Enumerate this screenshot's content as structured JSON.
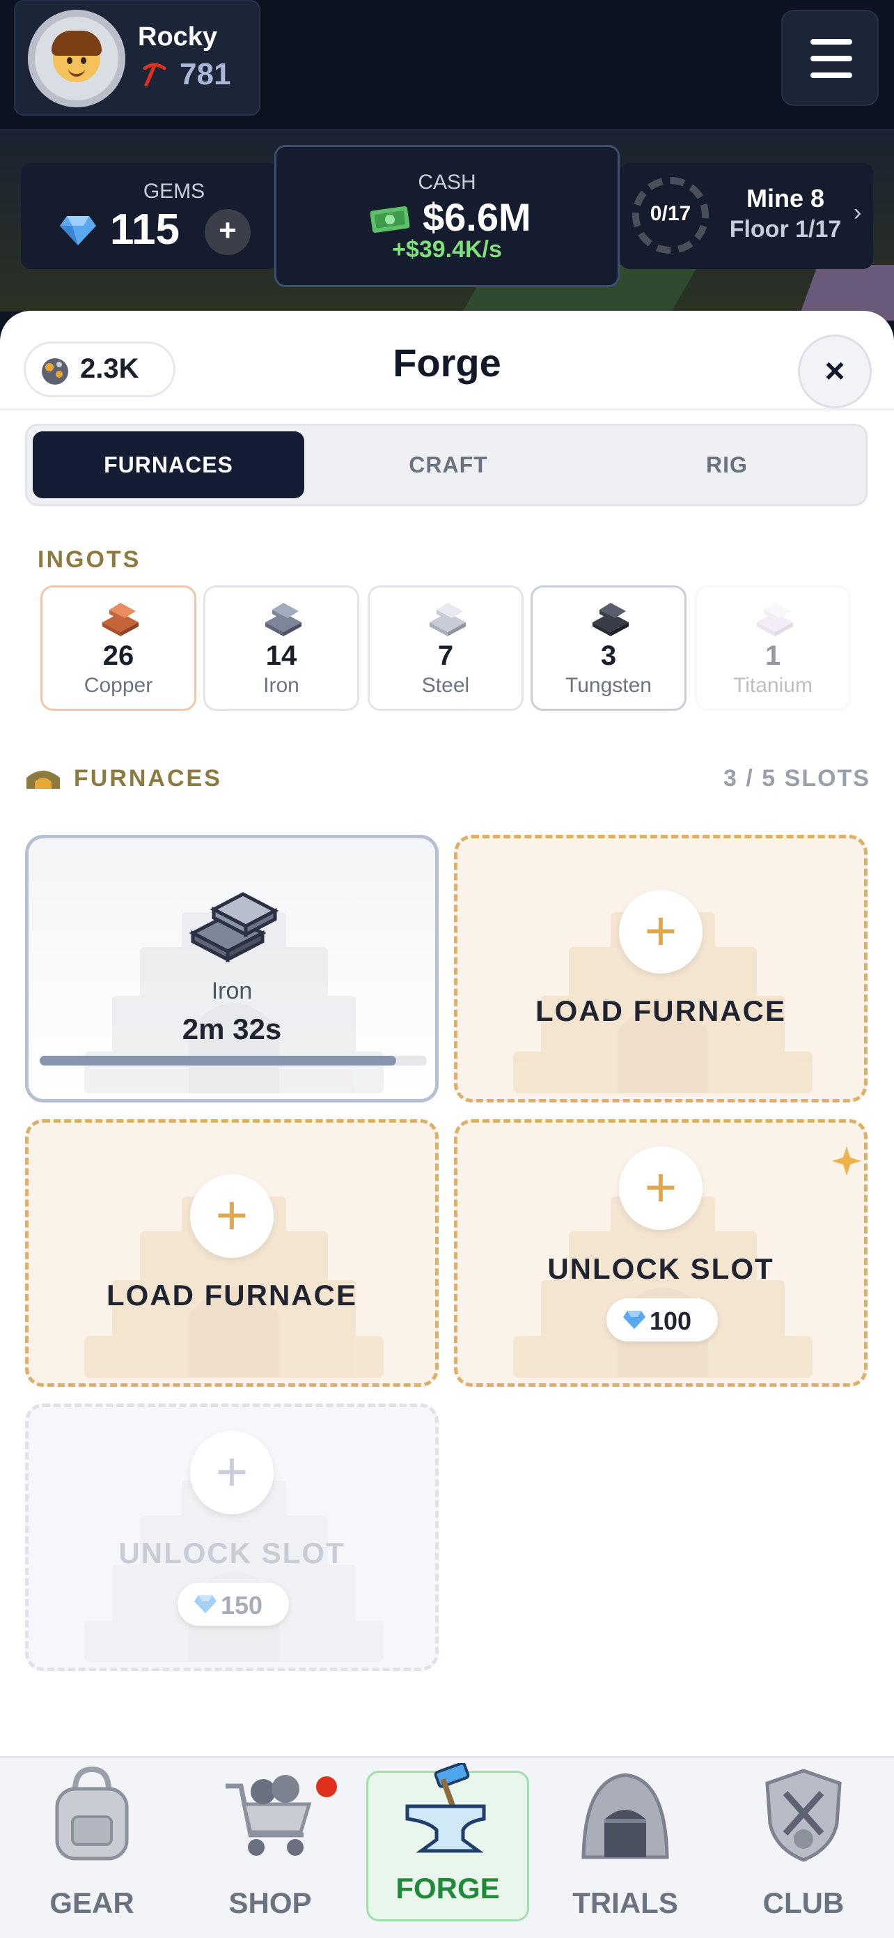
{
  "player": {
    "name": "Rocky",
    "level": "781"
  },
  "stats": {
    "gems_label": "GEMS",
    "gems_value": "115",
    "gems_add": "+",
    "cash_label": "CASH",
    "cash_value": "$6.6M",
    "cash_rate": "+$39.4K/s",
    "mine_progress": "0/17",
    "mine_title": "Mine 8",
    "mine_floor": "Floor 1/17",
    "mine_chevron": "›"
  },
  "sheet": {
    "ore_value": "2.3K",
    "title": "Forge",
    "close_symbol": "×",
    "tabs": [
      {
        "label": "FURNACES",
        "active": true
      },
      {
        "label": "CRAFT",
        "active": false
      },
      {
        "label": "RIG",
        "active": false
      }
    ],
    "ingots_label": "INGOTS",
    "ingots": [
      {
        "count": "26",
        "name": "Copper",
        "color": "#e07a4a"
      },
      {
        "count": "14",
        "name": "Iron",
        "color": "#8b95a8"
      },
      {
        "count": "7",
        "name": "Steel",
        "color": "#c7ccd6"
      },
      {
        "count": "3",
        "name": "Tungsten",
        "color": "#3a3d48"
      },
      {
        "count": "1",
        "name": "Titanium",
        "color": "#e8d8f0"
      }
    ],
    "furnaces_label": "FURNACES",
    "slots_count": "3 / 5 SLOTS",
    "slots": [
      {
        "state": "active",
        "item": "Iron",
        "timer": "2m 32s",
        "progress": 0.92
      },
      {
        "state": "empty",
        "label": "LOAD FURNACE",
        "plus": "+"
      },
      {
        "state": "empty",
        "label": "LOAD FURNACE",
        "plus": "+"
      },
      {
        "state": "locked",
        "label": "UNLOCK SLOT",
        "cost": "100",
        "plus": "+"
      },
      {
        "state": "disabled",
        "label": "UNLOCK SLOT",
        "cost": "150",
        "plus": "+"
      }
    ]
  },
  "nav": [
    {
      "label": "GEAR",
      "icon": "backpack-icon"
    },
    {
      "label": "SHOP",
      "icon": "cart-icon",
      "badge": true
    },
    {
      "label": "FORGE",
      "icon": "anvil-icon",
      "active": true
    },
    {
      "label": "TRIALS",
      "icon": "cave-icon"
    },
    {
      "label": "CLUB",
      "icon": "shield-icon"
    }
  ],
  "colors": {
    "accent_gold": "#8c7a3f",
    "dark_tab": "#141d33",
    "forge_green": "#1e8a3a",
    "dashed_border": "#ddb06a"
  }
}
